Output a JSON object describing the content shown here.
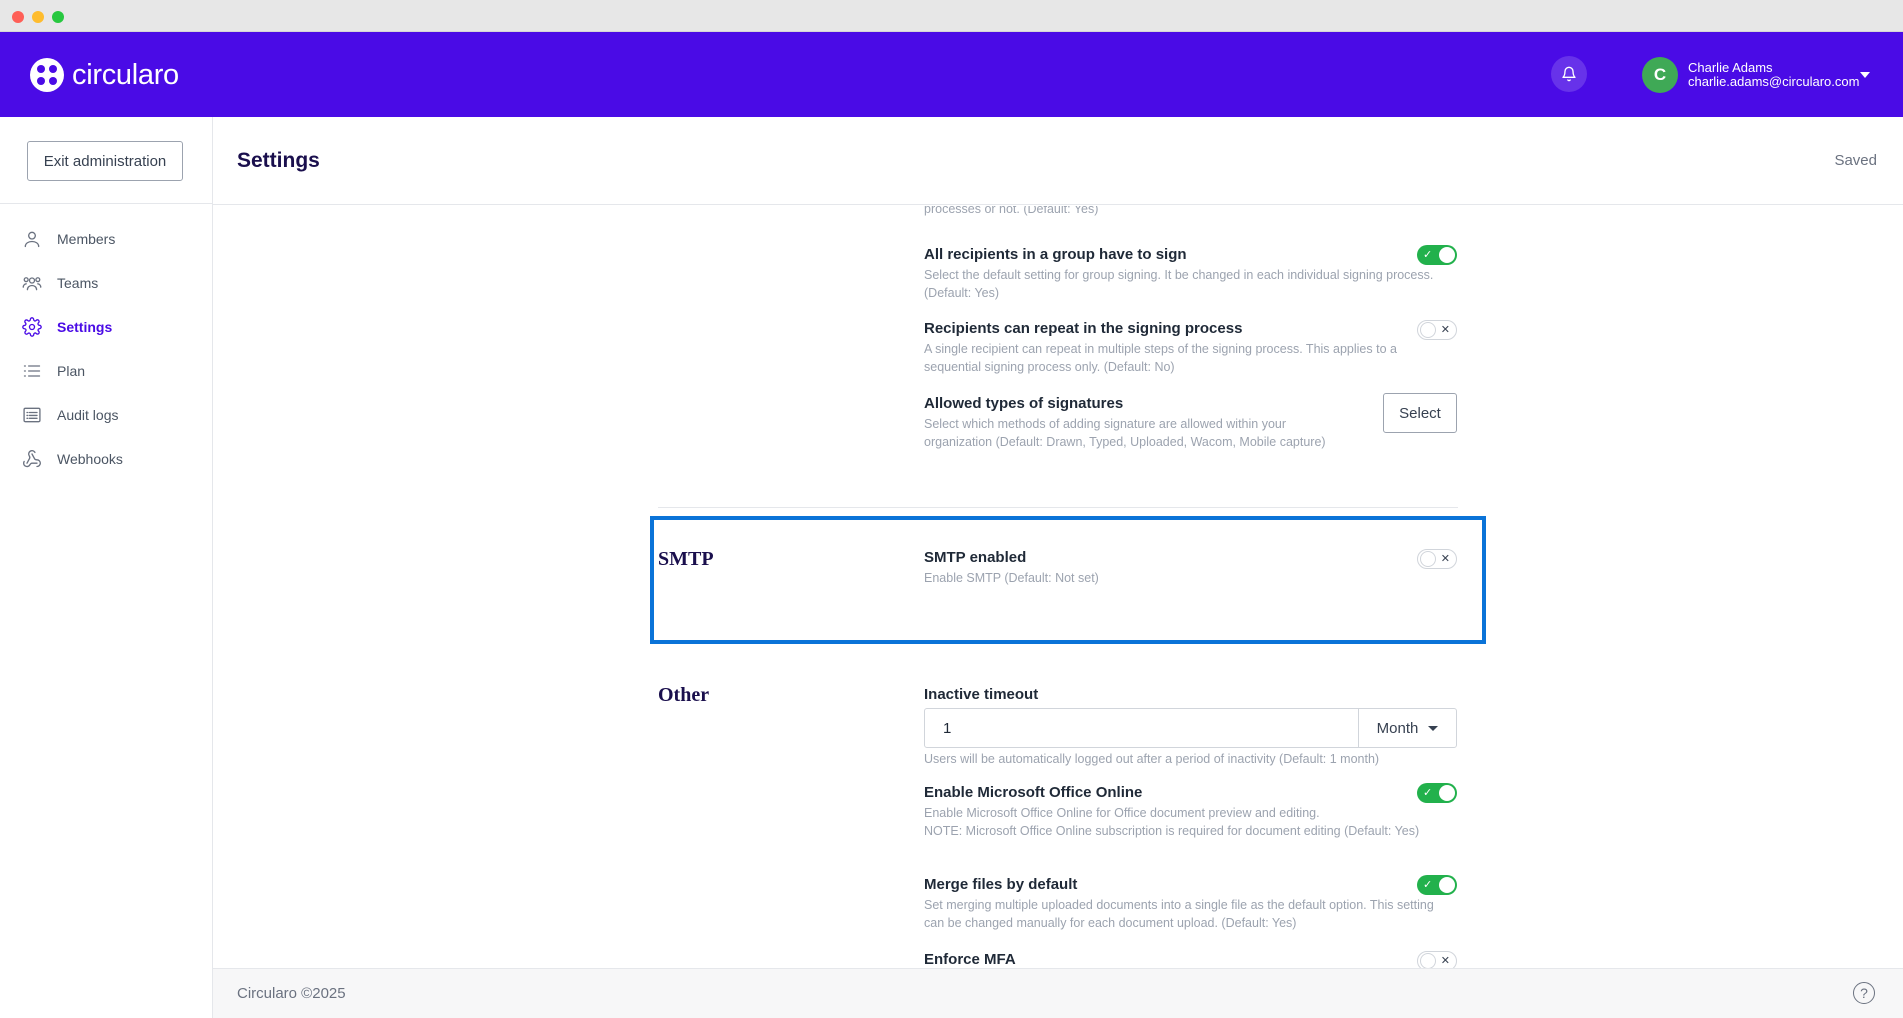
{
  "brand": {
    "name": "circularo",
    "primary_color": "#4a0be6"
  },
  "header": {
    "notification_icon": "bell-icon",
    "user": {
      "initial": "C",
      "name": "Charlie Adams",
      "email": "charlie.adams@circularo.com"
    }
  },
  "sidebar": {
    "exit_label": "Exit administration",
    "items": [
      {
        "label": "Members",
        "icon": "user-icon"
      },
      {
        "label": "Teams",
        "icon": "team-icon"
      },
      {
        "label": "Settings",
        "icon": "gear-icon",
        "active": true
      },
      {
        "label": "Plan",
        "icon": "list-icon"
      },
      {
        "label": "Audit logs",
        "icon": "log-icon"
      },
      {
        "label": "Webhooks",
        "icon": "webhook-icon"
      }
    ]
  },
  "page": {
    "title": "Settings",
    "status": "Saved"
  },
  "signing": {
    "truncated_desc": "processes or not.  (Default: Yes)",
    "group_sign": {
      "title": "All recipients in a group have to sign",
      "desc": "Select the default setting for group signing. It be changed in each individual signing process.  (Default: Yes)",
      "enabled": true
    },
    "repeat": {
      "title": "Recipients can repeat in the signing process",
      "desc": "A single recipient can repeat in multiple steps of the signing process. This applies to a sequential signing process only.  (Default: No)",
      "enabled": false
    },
    "signature_types": {
      "title": "Allowed types of signatures",
      "desc": "Select which methods of adding signature are allowed within your organization  (Default: Drawn, Typed, Uploaded, Wacom, Mobile capture)",
      "button": "Select"
    }
  },
  "smtp": {
    "heading": "SMTP",
    "enabled_setting": {
      "title": "SMTP enabled",
      "desc": "Enable SMTP  (Default: Not set)",
      "enabled": false
    }
  },
  "other": {
    "heading": "Other",
    "inactive_timeout": {
      "title": "Inactive timeout",
      "value": "1",
      "unit": "Month",
      "desc": "Users will be automatically logged out after a period of inactivity  (Default: 1 month)"
    },
    "office_online": {
      "title": "Enable Microsoft Office Online",
      "desc_line1": "Enable Microsoft Office Online for Office document preview and editing.",
      "desc_line2": "NOTE: Microsoft Office Online subscription is required for document editing  (Default: Yes)",
      "enabled": true
    },
    "merge_files": {
      "title": "Merge files by default",
      "desc": "Set merging multiple uploaded documents into a single file as the default option. This setting can be changed manually for each document upload.  (Default: Yes)",
      "enabled": true
    },
    "mfa": {
      "title": "Enforce MFA",
      "enabled": false
    }
  },
  "footer": {
    "copyright": "Circularo ©2025"
  }
}
